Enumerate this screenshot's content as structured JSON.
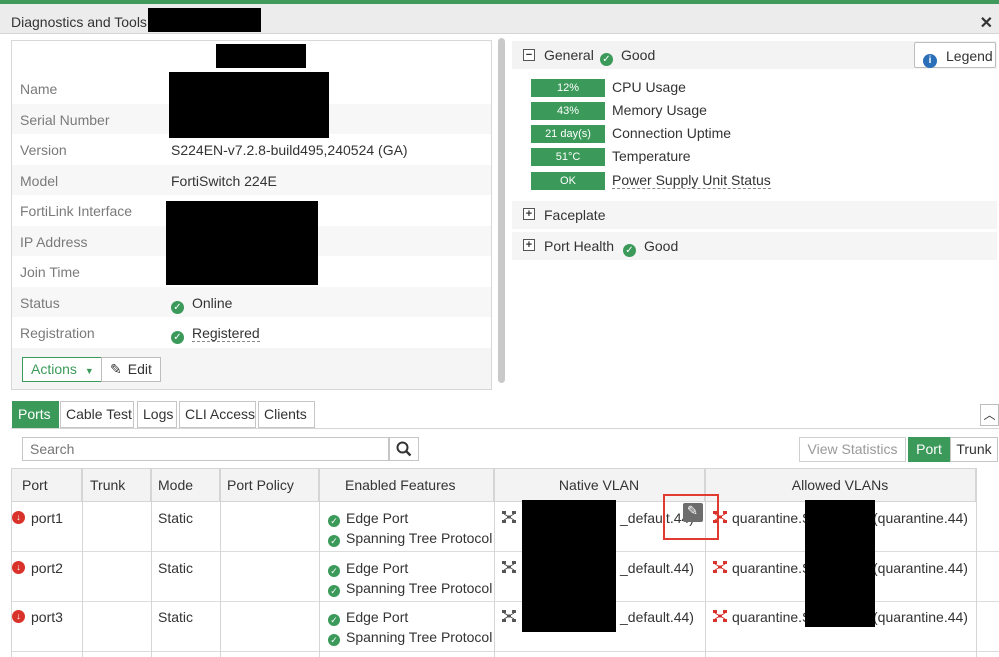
{
  "window": {
    "title": "Diagnostics and Tools -",
    "close_label": "✕"
  },
  "device": {
    "rows": [
      {
        "label": "Name",
        "value": ""
      },
      {
        "label": "Serial Number",
        "value": ""
      },
      {
        "label": "Version",
        "value": "S224EN-v7.2.8-build495,240524 (GA)"
      },
      {
        "label": "Model",
        "value": "FortiSwitch 224E"
      },
      {
        "label": "FortiLink Interface",
        "value": ""
      },
      {
        "label": "IP Address",
        "value": ""
      },
      {
        "label": "Join Time",
        "value": ""
      },
      {
        "label": "Status",
        "value": "Online"
      },
      {
        "label": "Registration",
        "value": "Registered"
      }
    ],
    "actions_label": "Actions",
    "edit_label": "Edit"
  },
  "general": {
    "title": "General",
    "status": "Good",
    "legend_label": "Legend",
    "metrics": [
      {
        "value": "12%",
        "label": "CPU Usage"
      },
      {
        "value": "43%",
        "label": "Memory Usage"
      },
      {
        "value": "21 day(s)",
        "label": "Connection Uptime"
      },
      {
        "value": "51°C",
        "label": "Temperature"
      },
      {
        "value": "OK",
        "label": "Power Supply Unit Status"
      }
    ]
  },
  "faceplate": {
    "title": "Faceplate"
  },
  "port_health": {
    "title": "Port Health",
    "status": "Good"
  },
  "tabs": [
    "Ports",
    "Cable Test",
    "Logs",
    "CLI Access",
    "Clients"
  ],
  "toolbar": {
    "search_placeholder": "Search",
    "view_statistics": "View Statistics",
    "port_toggle": "Port",
    "trunk_toggle": "Trunk"
  },
  "table": {
    "columns": [
      "Port",
      "Trunk",
      "Mode",
      "Port Policy",
      "Enabled Features",
      "Native VLAN",
      "Allowed VLANs"
    ],
    "rows": [
      {
        "port": "port1",
        "trunk": "",
        "mode": "Static",
        "policy": "",
        "features": [
          "Edge Port",
          "Spanning Tree Protocol"
        ],
        "native_vlan": "_default.44)",
        "allowed_prefix": "quarantine.S",
        "allowed_suffix": "(quarantine.44)"
      },
      {
        "port": "port2",
        "trunk": "",
        "mode": "Static",
        "policy": "",
        "features": [
          "Edge Port",
          "Spanning Tree Protocol"
        ],
        "native_vlan": "_default.44)",
        "allowed_prefix": "quarantine.S",
        "allowed_suffix": "(quarantine.44)"
      },
      {
        "port": "port3",
        "trunk": "",
        "mode": "Static",
        "policy": "",
        "features": [
          "Edge Port",
          "Spanning Tree Protocol"
        ],
        "native_vlan": "_default.44)",
        "allowed_prefix": "quarantine.S",
        "allowed_suffix": "(quarantine.44)"
      }
    ]
  },
  "colors": {
    "accent": "#3b9a5a",
    "down": "#d9322b",
    "highlight_box": "#e03a31"
  }
}
